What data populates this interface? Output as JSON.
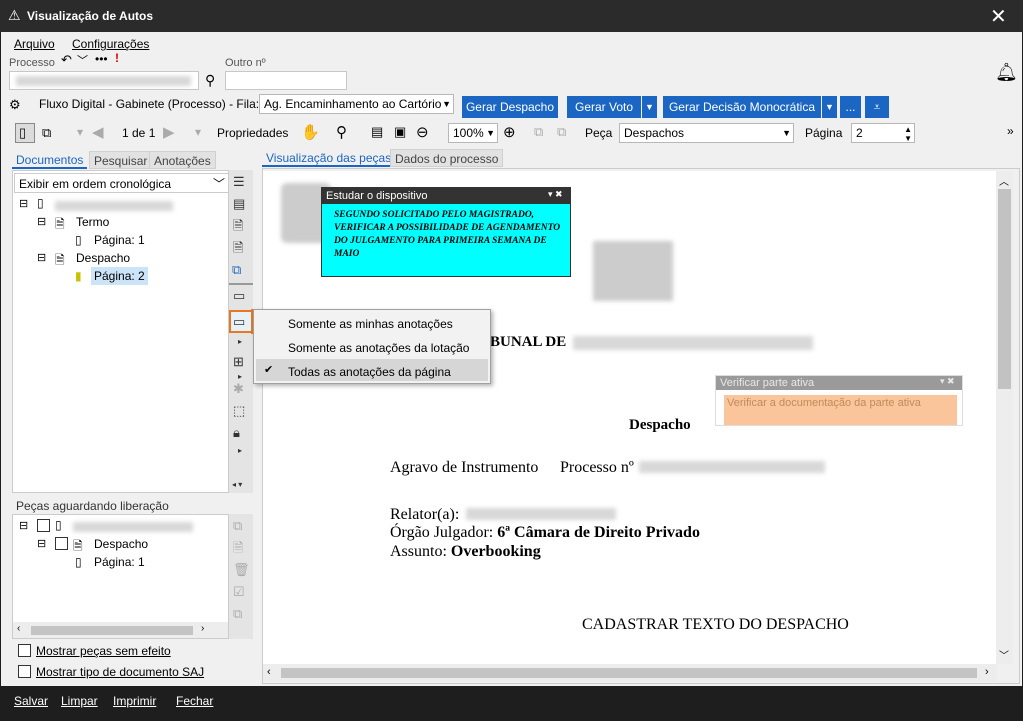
{
  "window": {
    "title": "Visualização de Autos",
    "close_glyph": "✕"
  },
  "menu": {
    "arquivo": "Arquivo",
    "configuracoes": "Configurações"
  },
  "process": {
    "label": "Processo",
    "outro_label": "Outro nº",
    "warn": "!"
  },
  "fluxo": {
    "text": "Fluxo Digital - Gabinete (Processo) - Fila:",
    "fila_value": "Ag. Encaminhamento ao Cartório",
    "gerar_despacho": "Gerar Despacho",
    "gerar_voto": "Gerar Voto",
    "gerar_decisao": "Gerar Decisão Monocrática",
    "more": "..."
  },
  "toolbar": {
    "page_of": "1 de 1",
    "propriedades": "Propriedades",
    "zoom": "100%",
    "peca_label": "Peça",
    "peca_value": "Despachos",
    "pagina_label": "Página",
    "pagina_value": "2"
  },
  "left_tabs": {
    "documentos": "Documentos",
    "pesquisar": "Pesquisar",
    "anotacoes": "Anotações"
  },
  "order_select": "Exibir em ordem cronológica",
  "tree": {
    "termo": "Termo",
    "pagina1": "Página: 1",
    "despacho": "Despacho",
    "pagina2": "Página: 2"
  },
  "pending": {
    "title": "Peças aguardando liberação",
    "despacho": "Despacho",
    "pagina1": "Página: 1"
  },
  "checkboxes": {
    "sem_efeito": "Mostrar peças sem efeito",
    "tipo_doc": "Mostrar tipo de documento SAJ"
  },
  "viewer_tabs": {
    "visualizacao": "Visualização das peças",
    "dados": "Dados do processo"
  },
  "context_menu": {
    "badge": "1",
    "item1": "Somente as minhas anotações",
    "item2": "Somente as anotações da lotação",
    "item3": "Todas as anotações da página",
    "check": "✔"
  },
  "note1": {
    "title": "Estudar o dispositivo",
    "body": "SEGUNDO SOLICITADO PELO MAGISTRADO, VERIFICAR A POSSIBILIDADE DE AGENDAMENTO DO JULGAMENTO PARA PRIMEIRA SEMANA DE MAIO"
  },
  "note2": {
    "title": "Verificar parte ativa",
    "body": "Verificar a documentação da parte ativa"
  },
  "document": {
    "header_partial": "BUNAL DE",
    "despacho_title": "Despacho",
    "agravo": "Agravo de Instrumento",
    "processo_no": "Processo nº",
    "relator": "Relator(a):",
    "orgao_label": "Órgão Julgador:",
    "orgao_value": "6ª Câmara de Direito Privado",
    "assunto_label": "Assunto:",
    "assunto_value": "Overbooking",
    "cadastrar": "CADASTRAR TEXTO DO DESPACHO"
  },
  "bottom": {
    "salvar": "Salvar",
    "limpar": "Limpar",
    "imprimir": "Imprimir",
    "fechar": "Fechar"
  },
  "colors": {
    "accent": "#1a66c2",
    "note1_bg": "#00ffff",
    "note2_bg": "#fbc59c",
    "badge": "#e87722"
  }
}
